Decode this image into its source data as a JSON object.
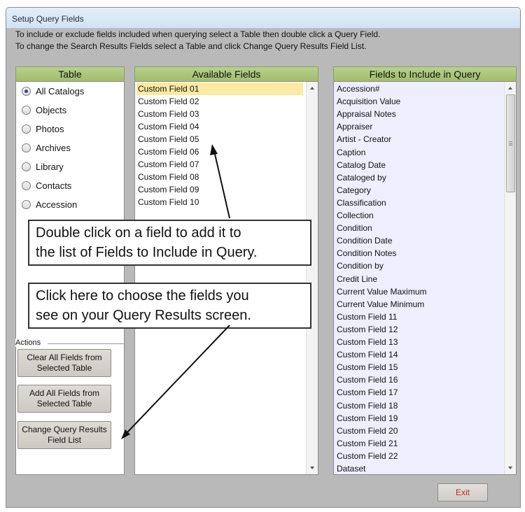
{
  "window": {
    "title": "Setup Query Fields"
  },
  "instructions": {
    "line1": "To include or exclude fields included when querying select a Table then double click a Query Field.",
    "line2": "To change the Search Results Fields select a Table and click Change Query Results Field List."
  },
  "table_panel": {
    "header": "Table",
    "options": [
      {
        "label": "All Catalogs",
        "checked": true
      },
      {
        "label": "Objects",
        "checked": false
      },
      {
        "label": "Photos",
        "checked": false
      },
      {
        "label": "Archives",
        "checked": false
      },
      {
        "label": "Library",
        "checked": false
      },
      {
        "label": "Contacts",
        "checked": false
      },
      {
        "label": "Accession",
        "checked": false
      }
    ]
  },
  "available_panel": {
    "header": "Available Fields",
    "items": [
      "Custom Field 01",
      "Custom Field 02",
      "Custom Field 03",
      "Custom Field 04",
      "Custom Field 05",
      "Custom Field 06",
      "Custom Field 07",
      "Custom Field 08",
      "Custom Field 09",
      "Custom Field 10"
    ],
    "selected_index": 0
  },
  "include_panel": {
    "header": "Fields to Include in Query",
    "items": [
      "Accession#",
      "Acquisition Value",
      "Appraisal Notes",
      "Appraiser",
      "Artist - Creator",
      "Caption",
      "Catalog Date",
      "Cataloged by",
      "Category",
      "Classification",
      "Collection",
      "Condition",
      "Condition Date",
      "Condition Notes",
      "Condition by",
      "Credit Line",
      "Current Value Maximum",
      "Current Value Minimum",
      "Custom Field 11",
      "Custom Field 12",
      "Custom Field 13",
      "Custom Field 14",
      "Custom Field 15",
      "Custom Field 16",
      "Custom Field 17",
      "Custom Field 18",
      "Custom Field 19",
      "Custom Field 20",
      "Custom Field 21",
      "Custom Field 22",
      "Dataset"
    ]
  },
  "callouts": {
    "double_click_line1": "Double click on a field to add it to",
    "double_click_line2": "the list of Fields to Include in Query.",
    "change_line1": "Click here to choose the fields you",
    "change_line2": "see on your Query Results screen."
  },
  "actions": {
    "label": "Actions",
    "clear_all": "Clear All Fields from Selected Table",
    "add_all": "Add All Fields from Selected Table",
    "change_results": "Change Query Results Field List"
  },
  "exit_label": "Exit",
  "colors": {
    "header_green": "#a9c57a",
    "selected_row": "#fbe9a4",
    "include_bg": "#eeeeff",
    "exit_text": "#c0261b"
  }
}
